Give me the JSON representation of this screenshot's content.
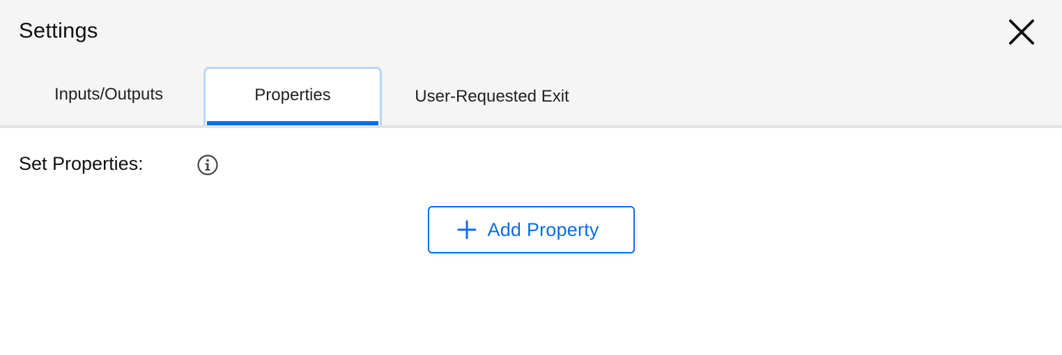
{
  "dialog": {
    "title": "Settings",
    "close_icon": "close-icon"
  },
  "tabs": [
    {
      "label": "Inputs/Outputs",
      "active": false
    },
    {
      "label": "Properties",
      "active": true
    },
    {
      "label": "User-Requested Exit",
      "active": false
    }
  ],
  "properties": {
    "section_label": "Set Properties:",
    "info_icon": "info-icon",
    "add_button_label": "Add Property",
    "add_button_icon": "plus-icon"
  },
  "colors": {
    "accent": "#0a6de8",
    "active_tab_outline": "#b9d6fb",
    "header_bg": "#f5f5f5",
    "body_bg": "#ffffff"
  }
}
